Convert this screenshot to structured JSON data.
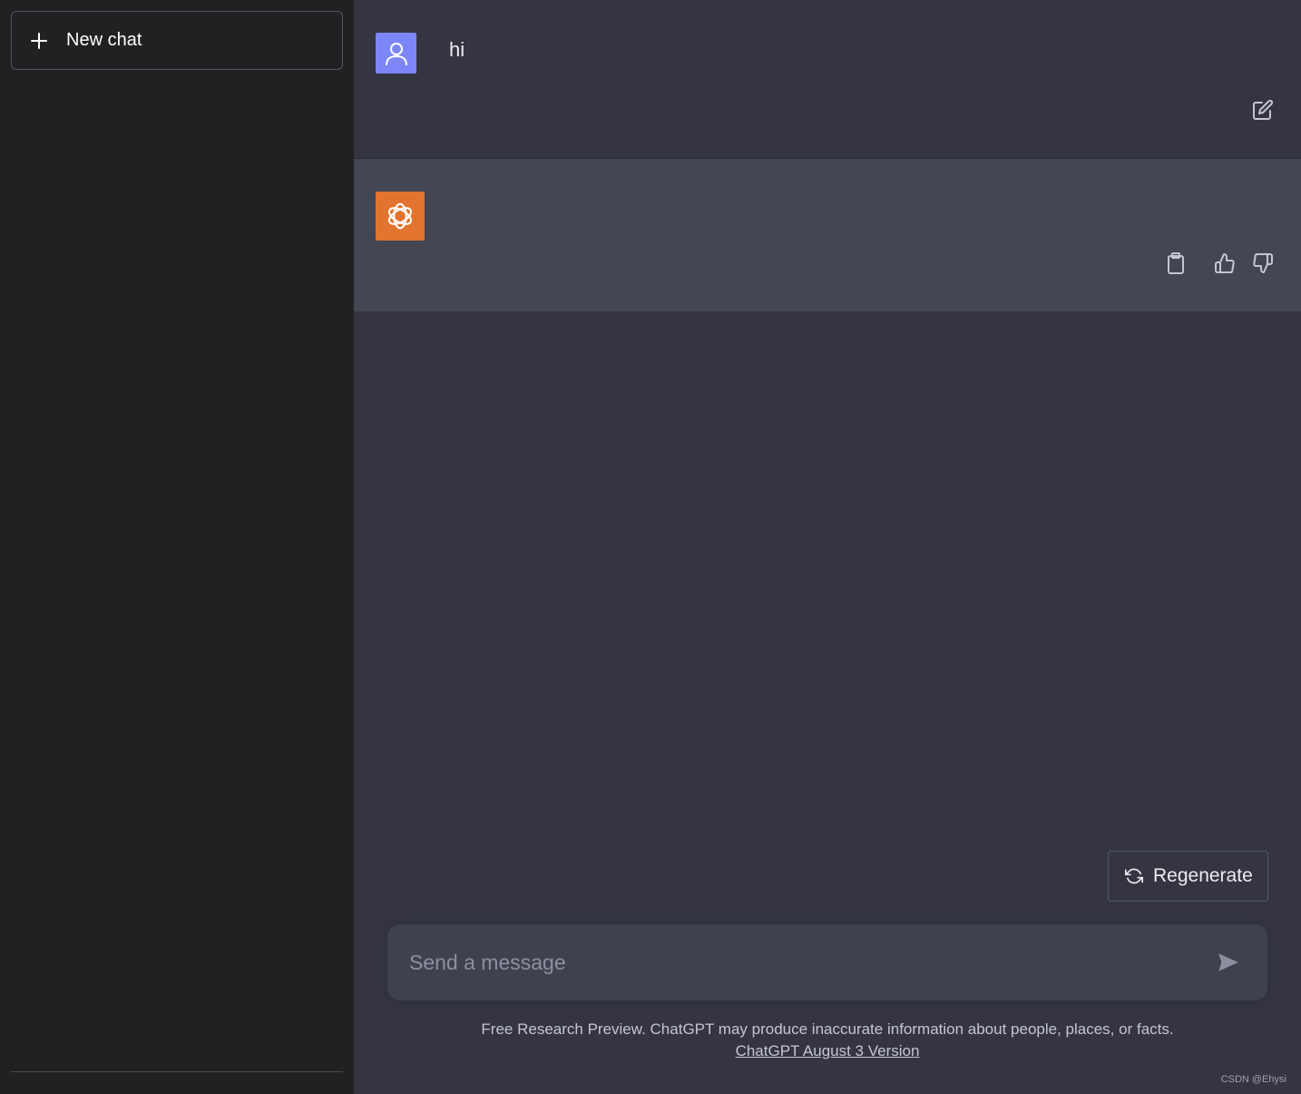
{
  "sidebar": {
    "new_chat_label": "New chat"
  },
  "conversation": {
    "user_message": "hi",
    "assistant_message": ""
  },
  "actions": {
    "regenerate_label": "Regenerate"
  },
  "composer": {
    "placeholder": "Send a message",
    "value": ""
  },
  "footer": {
    "disclaimer": "Free Research Preview. ChatGPT may produce inaccurate information about people, places, or facts.",
    "version_link": "ChatGPT August 3 Version"
  },
  "watermark": "CSDN @Ehysi",
  "colors": {
    "sidebar_bg": "#202123",
    "main_bg": "#343541",
    "assistant_row_bg": "#444654",
    "user_avatar": "#7c86f6",
    "bot_avatar": "#e2742f"
  },
  "icons": [
    "plus-icon",
    "user-icon",
    "openai-logo-icon",
    "edit-icon",
    "clipboard-icon",
    "thumbs-up-icon",
    "thumbs-down-icon",
    "refresh-icon",
    "send-icon"
  ]
}
